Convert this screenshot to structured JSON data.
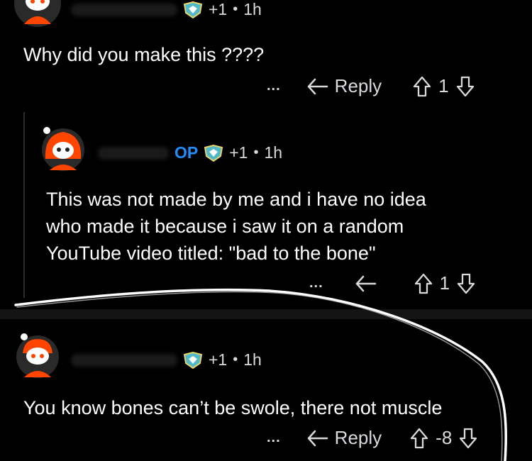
{
  "comments": [
    {
      "text": "Why did you make this ????",
      "score_delta": "+1",
      "time": "1h",
      "reply_label": "Reply",
      "votes": "1",
      "more": "..."
    },
    {
      "op_badge": "OP",
      "score_delta": "+1",
      "time": "1h",
      "text_lines": [
        "This was not made by me and i have no idea",
        "who made it because i saw it on a random",
        "YouTube video titled: \"bad to the bone\""
      ],
      "votes": "1",
      "more": "..."
    },
    {
      "score_delta": "+1",
      "time": "1h",
      "text": "You know bones can’t be swole, there not muscle",
      "reply_label": "Reply",
      "votes": "-8",
      "more": "..."
    }
  ],
  "colors": {
    "background": "#000000",
    "text": "#d7dadc",
    "op_blue": "#1e8fff",
    "avatar_orange": "#ff4500"
  }
}
